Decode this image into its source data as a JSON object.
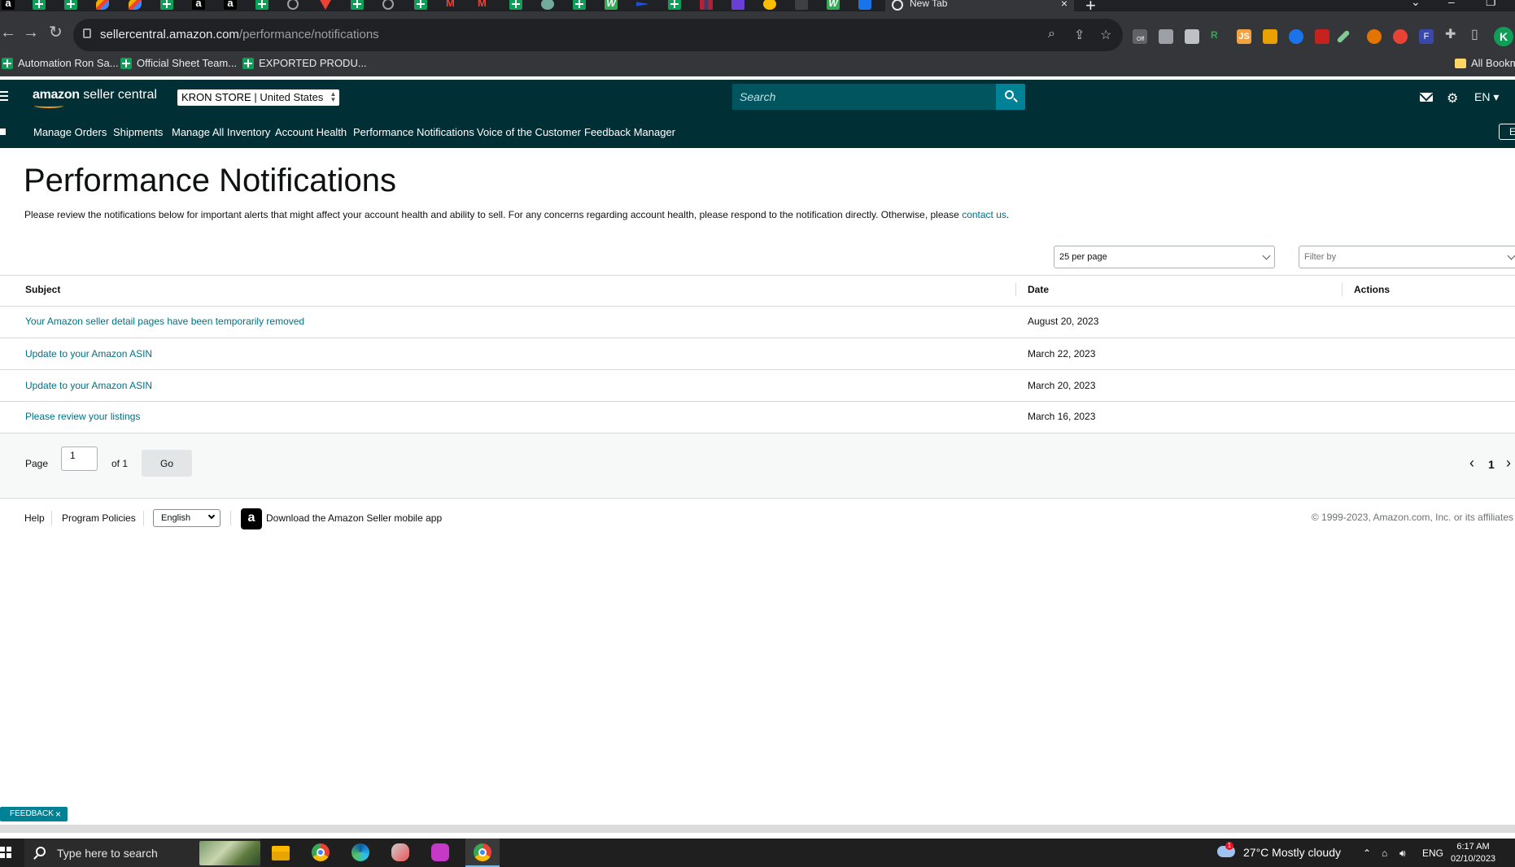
{
  "browser": {
    "active_tab_title": "New Tab",
    "url_host": "sellercentral.amazon.com",
    "url_path": "/performance/notifications",
    "bookmarks": [
      "Automation Ron Sa...",
      "Official Sheet Team...",
      "EXPORTED PRODU..."
    ],
    "all_bookmarks_label": "All Bookm",
    "profile_initial": "K",
    "extension_labels": {
      "off": "Off",
      "js": "JS",
      "r": "R",
      "f": "F"
    }
  },
  "header": {
    "logo_amazon": "amazon",
    "logo_seller_central": " seller central",
    "store_name": "KRON STORE",
    "store_region": "United States",
    "search_placeholder": "Search",
    "language": "EN"
  },
  "nav": {
    "items": [
      "Manage Orders",
      "Shipments",
      "Manage All Inventory",
      "Account Health",
      "Performance Notifications",
      "Voice of the Customer",
      "Feedback Manager"
    ],
    "edge_button": "E"
  },
  "page": {
    "title": "Performance Notifications",
    "description": "Please review the notifications below for important alerts that might affect your account health and ability to sell. For any concerns regarding account health, please respond to the notification directly. Otherwise, please ",
    "contact_link": "contact us",
    "description_end": ".",
    "per_page": "25 per page",
    "filter_placeholder": "Filter by"
  },
  "table": {
    "columns": [
      "Subject",
      "Date",
      "Actions"
    ],
    "rows": [
      {
        "subject": "Your Amazon seller detail pages have been temporarily removed",
        "date": "August 20, 2023"
      },
      {
        "subject": "Update to your Amazon ASIN",
        "date": "March 22, 2023"
      },
      {
        "subject": "Update to your Amazon ASIN",
        "date": "March 20, 2023"
      },
      {
        "subject": "Please review your listings",
        "date": "March 16, 2023"
      }
    ]
  },
  "pagination": {
    "page_label": "Page",
    "page_value": "1",
    "of_label": "of 1",
    "go_label": "Go",
    "current_page": "1",
    "prev_icon": "‹",
    "next_icon": "›"
  },
  "footer": {
    "help": "Help",
    "program_policies": "Program Policies",
    "language": "English",
    "app_download": "Download the Amazon Seller mobile app",
    "copyright": "© 1999-2023, Amazon.com, Inc. or its affiliates"
  },
  "feedback": {
    "label": "FEEDBACK",
    "close": "×"
  },
  "taskbar": {
    "search_placeholder": "Type here to search",
    "weather": "27°C  Mostly cloudy",
    "weather_badge": "1",
    "language": "ENG",
    "time": "6:17 AM",
    "date": "02/10/2023"
  },
  "colors": {
    "header_bg": "#002f36",
    "link": "#007185",
    "search_button": "#008296"
  }
}
